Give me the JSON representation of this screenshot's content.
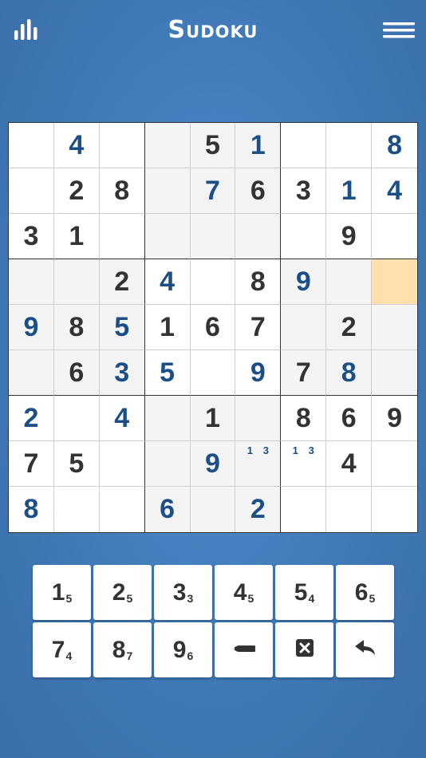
{
  "header": {
    "title": "Sudoku",
    "left_icon": "stats-bars-icon",
    "right_icon": "hamburger-menu-icon"
  },
  "board": {
    "selected": {
      "row": 4,
      "col": 9
    },
    "cells": [
      [
        {
          "v": "",
          "t": ""
        },
        {
          "v": "4",
          "t": "user"
        },
        {
          "v": "",
          "t": ""
        },
        {
          "v": "",
          "t": ""
        },
        {
          "v": "5",
          "t": "given"
        },
        {
          "v": "1",
          "t": "user"
        },
        {
          "v": "",
          "t": ""
        },
        {
          "v": "",
          "t": ""
        },
        {
          "v": "8",
          "t": "user"
        }
      ],
      [
        {
          "v": "",
          "t": ""
        },
        {
          "v": "2",
          "t": "given"
        },
        {
          "v": "8",
          "t": "given"
        },
        {
          "v": "",
          "t": ""
        },
        {
          "v": "7",
          "t": "user"
        },
        {
          "v": "6",
          "t": "given"
        },
        {
          "v": "3",
          "t": "given"
        },
        {
          "v": "1",
          "t": "user"
        },
        {
          "v": "4",
          "t": "user"
        }
      ],
      [
        {
          "v": "3",
          "t": "given"
        },
        {
          "v": "1",
          "t": "given"
        },
        {
          "v": "",
          "t": ""
        },
        {
          "v": "",
          "t": ""
        },
        {
          "v": "",
          "t": ""
        },
        {
          "v": "",
          "t": ""
        },
        {
          "v": "",
          "t": ""
        },
        {
          "v": "9",
          "t": "given"
        },
        {
          "v": "",
          "t": ""
        }
      ],
      [
        {
          "v": "",
          "t": ""
        },
        {
          "v": "",
          "t": ""
        },
        {
          "v": "2",
          "t": "given"
        },
        {
          "v": "4",
          "t": "user"
        },
        {
          "v": "",
          "t": ""
        },
        {
          "v": "8",
          "t": "given"
        },
        {
          "v": "9",
          "t": "user"
        },
        {
          "v": "",
          "t": ""
        },
        {
          "v": "",
          "t": ""
        }
      ],
      [
        {
          "v": "9",
          "t": "user"
        },
        {
          "v": "8",
          "t": "given"
        },
        {
          "v": "5",
          "t": "user"
        },
        {
          "v": "1",
          "t": "given"
        },
        {
          "v": "6",
          "t": "given"
        },
        {
          "v": "7",
          "t": "given"
        },
        {
          "v": "",
          "t": ""
        },
        {
          "v": "2",
          "t": "given"
        },
        {
          "v": "",
          "t": ""
        }
      ],
      [
        {
          "v": "",
          "t": ""
        },
        {
          "v": "6",
          "t": "given"
        },
        {
          "v": "3",
          "t": "user"
        },
        {
          "v": "5",
          "t": "user"
        },
        {
          "v": "",
          "t": ""
        },
        {
          "v": "9",
          "t": "user"
        },
        {
          "v": "7",
          "t": "given"
        },
        {
          "v": "8",
          "t": "user"
        },
        {
          "v": "",
          "t": ""
        }
      ],
      [
        {
          "v": "2",
          "t": "user"
        },
        {
          "v": "",
          "t": ""
        },
        {
          "v": "4",
          "t": "user"
        },
        {
          "v": "",
          "t": ""
        },
        {
          "v": "1",
          "t": "given"
        },
        {
          "v": "",
          "t": ""
        },
        {
          "v": "8",
          "t": "given"
        },
        {
          "v": "6",
          "t": "given"
        },
        {
          "v": "9",
          "t": "given"
        }
      ],
      [
        {
          "v": "7",
          "t": "given"
        },
        {
          "v": "5",
          "t": "given"
        },
        {
          "v": "",
          "t": ""
        },
        {
          "v": "",
          "t": ""
        },
        {
          "v": "9",
          "t": "user"
        },
        {
          "v": "",
          "t": "",
          "notes": [
            "1",
            "3"
          ]
        },
        {
          "v": "",
          "t": "",
          "notes": [
            "1",
            "3"
          ]
        },
        {
          "v": "4",
          "t": "given"
        },
        {
          "v": "",
          "t": ""
        }
      ],
      [
        {
          "v": "8",
          "t": "user"
        },
        {
          "v": "",
          "t": ""
        },
        {
          "v": "",
          "t": ""
        },
        {
          "v": "6",
          "t": "user"
        },
        {
          "v": "",
          "t": ""
        },
        {
          "v": "2",
          "t": "user"
        },
        {
          "v": "",
          "t": ""
        },
        {
          "v": "",
          "t": ""
        },
        {
          "v": "",
          "t": ""
        }
      ]
    ]
  },
  "keypad": {
    "numbers": [
      {
        "digit": "1",
        "remaining": "5"
      },
      {
        "digit": "2",
        "remaining": "5"
      },
      {
        "digit": "3",
        "remaining": "3"
      },
      {
        "digit": "4",
        "remaining": "5"
      },
      {
        "digit": "5",
        "remaining": "4"
      },
      {
        "digit": "6",
        "remaining": "5"
      },
      {
        "digit": "7",
        "remaining": "4"
      },
      {
        "digit": "8",
        "remaining": "7"
      },
      {
        "digit": "9",
        "remaining": "6"
      }
    ],
    "tools": [
      "pencil-icon",
      "erase-icon",
      "undo-icon"
    ]
  },
  "colors": {
    "background": "#3f78b6",
    "given_digit": "#333333",
    "user_digit": "#1c4f86",
    "selected_cell": "#fde0ad",
    "shaded_cell": "#f4f4f4"
  }
}
